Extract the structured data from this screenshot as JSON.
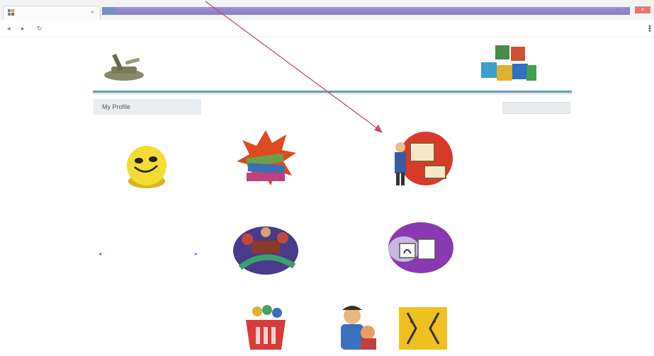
{
  "browser": {
    "tab_title": "",
    "url": "",
    "back_icon": "back-icon",
    "forward_icon": "forward-icon",
    "reload_icon": "reload-icon",
    "menu_icon": "menu-icon"
  },
  "header": {
    "site_name": "",
    "tagline": "",
    "logo_caption": "",
    "logout": ""
  },
  "nav": {
    "profile_tab": "My Profile",
    "info_text": "",
    "info_text_2": "",
    "setting_button": ""
  },
  "sidebar": {
    "user_line": "",
    "calendar_title": "",
    "calendar_month": "",
    "weekdays": [
      "",
      "",
      "",
      "",
      "",
      "",
      ""
    ],
    "link": ""
  },
  "tiles": [
    {
      "icon": "books-icon",
      "label": ""
    },
    {
      "icon": "teacher-board-icon",
      "label": ""
    },
    {
      "icon": "classroom-icon",
      "label": ""
    },
    {
      "icon": "presentation-icon",
      "label": "",
      "label2": ""
    },
    {
      "icon": "basket-icon",
      "label": ""
    },
    {
      "icon": "student-icon",
      "label": ""
    },
    {
      "icon": "faces-icon",
      "label": ""
    }
  ],
  "side_label": "",
  "colors": {
    "accent_bar": "#9b8fd4",
    "header_rule": "#6a9aa8",
    "link": "#5b9bc7",
    "arrow": "#c0506a"
  }
}
